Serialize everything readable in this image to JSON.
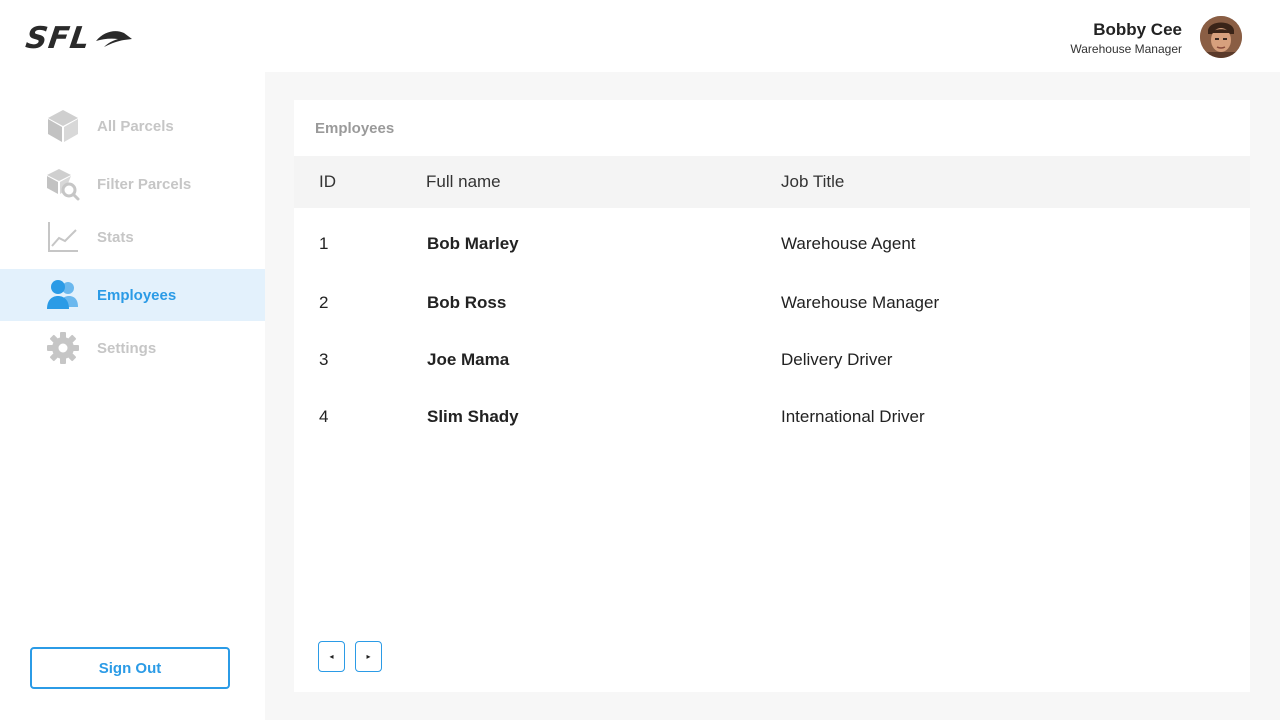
{
  "brand": {
    "logo_text": "SFL",
    "accent": "#2b9be6"
  },
  "user": {
    "name": "Bobby Cee",
    "role": "Warehouse Manager"
  },
  "sidebar": {
    "items": [
      {
        "label": "All Parcels",
        "icon": "box-icon"
      },
      {
        "label": "Filter Parcels",
        "icon": "box-search-icon"
      },
      {
        "label": "Stats",
        "icon": "chart-line-icon"
      },
      {
        "label": "Employees",
        "icon": "users-icon",
        "active": true
      },
      {
        "label": "Settings",
        "icon": "gear-icon"
      }
    ],
    "signout_label": "Sign Out"
  },
  "employees": {
    "title": "Employees",
    "columns": [
      "ID",
      "Full name",
      "Job Title"
    ],
    "rows": [
      {
        "id": "1",
        "name": "Bob Marley",
        "title": "Warehouse Agent"
      },
      {
        "id": "2",
        "name": "Bob Ross",
        "title": "Warehouse Manager"
      },
      {
        "id": "3",
        "name": "Joe Mama",
        "title": "Delivery Driver"
      },
      {
        "id": "4",
        "name": "Slim Shady",
        "title": "International Driver"
      }
    ],
    "pager": {
      "prev": "◂",
      "next": "▸"
    }
  }
}
